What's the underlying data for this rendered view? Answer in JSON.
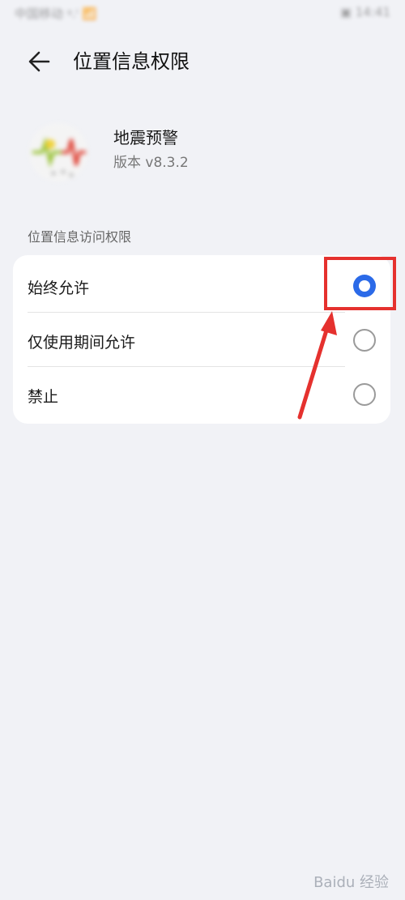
{
  "status_bar": {
    "left_text": "中国移动 ᵍ.ᴵ 📶",
    "right_text": "▣ 14:41"
  },
  "header": {
    "title": "位置信息权限"
  },
  "app": {
    "name": "地震预警",
    "version": "版本 v8.3.2"
  },
  "section": {
    "label": "位置信息访问权限"
  },
  "options": [
    {
      "label": "始终允许",
      "selected": true
    },
    {
      "label": "仅使用期间允许",
      "selected": false
    },
    {
      "label": "禁止",
      "selected": false
    }
  ],
  "annotation": {
    "color": "#e5312e"
  },
  "watermark": {
    "text": "Baidu 经验"
  },
  "colors": {
    "accent": "#2b6ae8",
    "background": "#f1f2f6",
    "annotation_red": "#e5312e"
  }
}
